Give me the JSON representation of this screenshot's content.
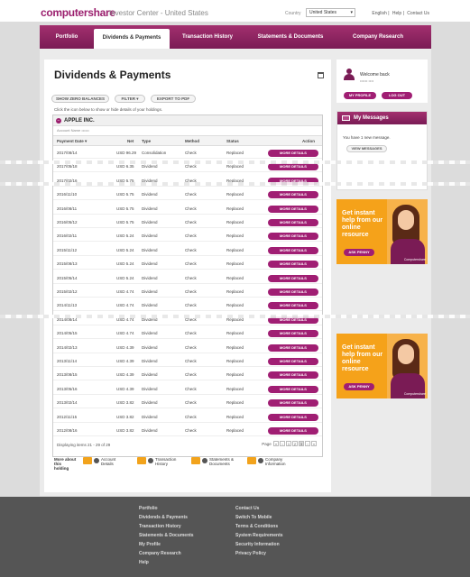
{
  "header": {
    "logo": "computershare",
    "subtitle": "Investor Center - United States",
    "country_label": "Country",
    "country_value": "United States",
    "links": [
      "English",
      "Help",
      "Contact Us"
    ]
  },
  "nav": [
    "Portfolio",
    "Dividends & Payments",
    "Transaction History",
    "Statements & Documents",
    "Company Research"
  ],
  "main": {
    "title": "Dividends & Payments",
    "toolbar": [
      "SHOW ZERO BALANCES",
      "FILTER ▾",
      "EXPORT TO PDF"
    ],
    "hint": "Click the icon below to show or hide details of your holdings.",
    "company": "APPLE INC.",
    "account": "Account Name  ••••••",
    "columns": [
      "Payment Date ▾",
      "Net",
      "Type",
      "Method",
      "Status",
      "Action"
    ],
    "rows": [
      [
        "2017/08/14",
        "USD 96.29",
        "Consolidation",
        "Check",
        "Replaced",
        "MORE DETAILS"
      ],
      [
        "2017/05/18",
        "USD 6.35",
        "Dividend",
        "Check",
        "Replaced",
        "MORE DETAILS"
      ],
      [
        "2017/02/16",
        "USD 5.75",
        "Dividend",
        "Check",
        "Replaced",
        "MORE DETAILS"
      ],
      [
        "2016/11/10",
        "USD 5.75",
        "Dividend",
        "Check",
        "Replaced",
        "MORE DETAILS"
      ],
      [
        "2016/08/11",
        "USD 5.75",
        "Dividend",
        "Check",
        "Replaced",
        "MORE DETAILS"
      ],
      [
        "2016/05/12",
        "USD 5.75",
        "Dividend",
        "Check",
        "Replaced",
        "MORE DETAILS"
      ],
      [
        "2016/02/11",
        "USD 5.24",
        "Dividend",
        "Check",
        "Replaced",
        "MORE DETAILS"
      ],
      [
        "2015/11/12",
        "USD 5.24",
        "Dividend",
        "Check",
        "Replaced",
        "MORE DETAILS"
      ],
      [
        "2015/08/13",
        "USD 5.24",
        "Dividend",
        "Check",
        "Replaced",
        "MORE DETAILS"
      ],
      [
        "2015/05/14",
        "USD 5.24",
        "Dividend",
        "Check",
        "Replaced",
        "MORE DETAILS"
      ],
      [
        "2015/02/12",
        "USD 4.74",
        "Dividend",
        "Check",
        "Replaced",
        "MORE DETAILS"
      ],
      [
        "2014/11/13",
        "USD 4.74",
        "Dividend",
        "Check",
        "Replaced",
        "MORE DETAILS"
      ],
      [
        "2014/08/14",
        "USD 4.74",
        "Dividend",
        "Check",
        "Replaced",
        "MORE DETAILS"
      ],
      [
        "2014/05/15",
        "USD 4.74",
        "Dividend",
        "Check",
        "Replaced",
        "MORE DETAILS"
      ],
      [
        "2014/02/13",
        "USD 4.39",
        "Dividend",
        "Check",
        "Replaced",
        "MORE DETAILS"
      ],
      [
        "2013/11/14",
        "USD 4.39",
        "Dividend",
        "Check",
        "Replaced",
        "MORE DETAILS"
      ],
      [
        "2013/08/15",
        "USD 4.39",
        "Dividend",
        "Check",
        "Replaced",
        "MORE DETAILS"
      ],
      [
        "2013/05/16",
        "USD 4.39",
        "Dividend",
        "Check",
        "Replaced",
        "MORE DETAILS"
      ],
      [
        "2013/02/14",
        "USD 3.82",
        "Dividend",
        "Check",
        "Replaced",
        "MORE DETAILS"
      ],
      [
        "2012/11/15",
        "USD 3.82",
        "Dividend",
        "Check",
        "Replaced",
        "MORE DETAILS"
      ],
      [
        "2012/08/16",
        "USD 3.82",
        "Dividend",
        "Check",
        "Replaced",
        "MORE DETAILS"
      ]
    ],
    "pager_info": "Displaying items 21 - 29 of 29",
    "page_label": "Page",
    "pages": [
      "«",
      "‹",
      "1",
      "2",
      "3",
      "›",
      "»"
    ],
    "more_about": {
      "label": "More about this holding",
      "items": [
        "Account Details",
        "Transaction History",
        "Statements & Documents",
        "Company Information"
      ]
    }
  },
  "sidebar": {
    "welcome": "Welcome back",
    "username": "•••••• ••••",
    "buttons": [
      "MY PROFILE",
      "LOG OUT"
    ],
    "messages_title": "My Messages",
    "messages_text": "You have 1 new message.",
    "view_messages": "VIEW MESSAGES",
    "ad_text": "Get instant help from our online resource",
    "ad_button": "ASK PENNY",
    "ad_brand": "Computershare"
  },
  "footer": {
    "col1": [
      "Portfolio",
      "Dividends & Payments",
      "Transaction History",
      "Statements & Documents",
      "My Profile",
      "Company Research",
      "Help"
    ],
    "col2": [
      "Contact Us",
      "Switch To Mobile",
      "Terms & Conditions",
      "System Requirements",
      "Security Information",
      "Privacy Policy"
    ]
  }
}
